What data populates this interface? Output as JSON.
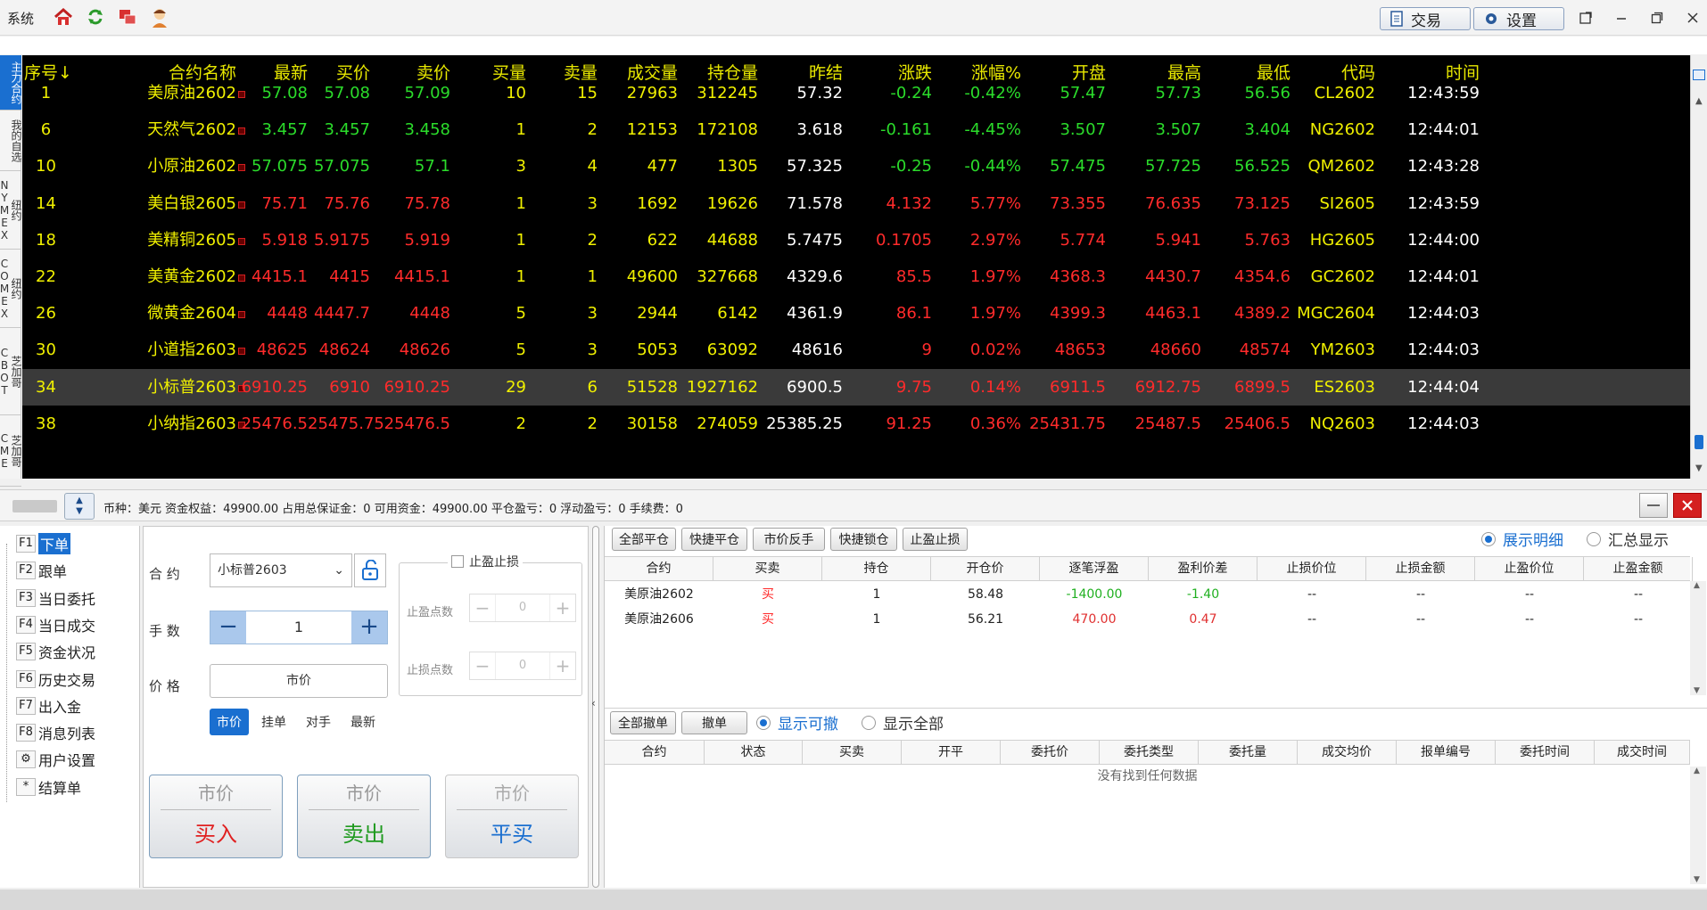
{
  "titlebar": {
    "system_label": "系统",
    "trade_button": "交易",
    "settings_button": "设置",
    "icons": [
      "home-icon",
      "refresh-icon",
      "windows-icon",
      "user-avatar-icon"
    ]
  },
  "side_tabs": [
    "主力合约",
    "我的自选",
    "纽约NYMEX",
    "纽约COMEX",
    "芝加哥CBOT",
    "芝加哥CME"
  ],
  "market": {
    "headers": [
      "序号↓",
      "合约名称",
      "最新",
      "买价",
      "卖价",
      "买量",
      "卖量",
      "成交量",
      "持仓量",
      "昨结",
      "涨跌",
      "涨幅%",
      "开盘",
      "最高",
      "最低",
      "代码",
      "时间"
    ],
    "rows": [
      {
        "no": "1",
        "name": "美原油2602",
        "last": "57.08",
        "bid": "57.08",
        "ask": "57.09",
        "bidv": "10",
        "askv": "15",
        "vol": "27963",
        "oi": "312245",
        "prev": "57.32",
        "chg": "-0.24",
        "pct": "-0.42%",
        "open": "57.47",
        "high": "57.73",
        "low": "56.56",
        "code": "CL2602",
        "time": "12:43:59",
        "dir": "down"
      },
      {
        "no": "6",
        "name": "天然气2602",
        "last": "3.457",
        "bid": "3.457",
        "ask": "3.458",
        "bidv": "1",
        "askv": "2",
        "vol": "12153",
        "oi": "172108",
        "prev": "3.618",
        "chg": "-0.161",
        "pct": "-4.45%",
        "open": "3.507",
        "high": "3.507",
        "low": "3.404",
        "code": "NG2602",
        "time": "12:44:01",
        "dir": "down"
      },
      {
        "no": "10",
        "name": "小原油2602",
        "last": "57.075",
        "bid": "57.075",
        "ask": "57.1",
        "bidv": "3",
        "askv": "4",
        "vol": "477",
        "oi": "1305",
        "prev": "57.325",
        "chg": "-0.25",
        "pct": "-0.44%",
        "open": "57.475",
        "high": "57.725",
        "low": "56.525",
        "code": "QM2602",
        "time": "12:43:28",
        "dir": "down"
      },
      {
        "no": "14",
        "name": "美白银2605",
        "last": "75.71",
        "bid": "75.76",
        "ask": "75.78",
        "bidv": "1",
        "askv": "3",
        "vol": "1692",
        "oi": "19626",
        "prev": "71.578",
        "chg": "4.132",
        "pct": "5.77%",
        "open": "73.355",
        "high": "76.635",
        "low": "73.125",
        "code": "SI2605",
        "time": "12:43:59",
        "dir": "up"
      },
      {
        "no": "18",
        "name": "美精铜2605",
        "last": "5.918",
        "bid": "5.9175",
        "ask": "5.919",
        "bidv": "1",
        "askv": "2",
        "vol": "622",
        "oi": "44688",
        "prev": "5.7475",
        "chg": "0.1705",
        "pct": "2.97%",
        "open": "5.774",
        "high": "5.941",
        "low": "5.763",
        "code": "HG2605",
        "time": "12:44:00",
        "dir": "up"
      },
      {
        "no": "22",
        "name": "美黄金2602",
        "last": "4415.1",
        "bid": "4415",
        "ask": "4415.1",
        "bidv": "1",
        "askv": "1",
        "vol": "49600",
        "oi": "327668",
        "prev": "4329.6",
        "chg": "85.5",
        "pct": "1.97%",
        "open": "4368.3",
        "high": "4430.7",
        "low": "4354.6",
        "code": "GC2602",
        "time": "12:44:01",
        "dir": "up"
      },
      {
        "no": "26",
        "name": "微黄金2604",
        "last": "4448",
        "bid": "4447.7",
        "ask": "4448",
        "bidv": "5",
        "askv": "3",
        "vol": "2944",
        "oi": "6142",
        "prev": "4361.9",
        "chg": "86.1",
        "pct": "1.97%",
        "open": "4399.3",
        "high": "4463.1",
        "low": "4389.2",
        "code": "MGC2604",
        "time": "12:44:03",
        "dir": "up"
      },
      {
        "no": "30",
        "name": "小道指2603",
        "last": "48625",
        "bid": "48624",
        "ask": "48626",
        "bidv": "5",
        "askv": "3",
        "vol": "5053",
        "oi": "63092",
        "prev": "48616",
        "chg": "9",
        "pct": "0.02%",
        "open": "48653",
        "high": "48660",
        "low": "48574",
        "code": "YM2603",
        "time": "12:44:03",
        "dir": "up"
      },
      {
        "no": "34",
        "name": "小标普2603",
        "last": "6910.25",
        "bid": "6910",
        "ask": "6910.25",
        "bidv": "29",
        "askv": "6",
        "vol": "51528",
        "oi": "1927162",
        "prev": "6900.5",
        "chg": "9.75",
        "pct": "0.14%",
        "open": "6911.5",
        "high": "6912.75",
        "low": "6899.5",
        "code": "ES2603",
        "time": "12:44:04",
        "dir": "up",
        "selected": true
      },
      {
        "no": "38",
        "name": "小纳指2603",
        "last": "25476.5",
        "bid": "25475.75",
        "ask": "25476.5",
        "bidv": "2",
        "askv": "2",
        "vol": "30158",
        "oi": "274059",
        "prev": "25385.25",
        "chg": "91.25",
        "pct": "0.36%",
        "open": "25431.75",
        "high": "25487.5",
        "low": "25406.5",
        "code": "NQ2603",
        "time": "12:44:03",
        "dir": "up"
      }
    ]
  },
  "status": {
    "text": "币种：美元   资金权益：49900.00   占用总保证金：0   可用资金：49900.00   平仓盈亏：0   浮动盈亏：0   手续费：0"
  },
  "nav": [
    {
      "key": "F1",
      "label": "下单",
      "active": true
    },
    {
      "key": "F2",
      "label": "跟单"
    },
    {
      "key": "F3",
      "label": "当日委托"
    },
    {
      "key": "F4",
      "label": "当日成交"
    },
    {
      "key": "F5",
      "label": "资金状况"
    },
    {
      "key": "F6",
      "label": "历史交易"
    },
    {
      "key": "F7",
      "label": "出入金"
    },
    {
      "key": "F8",
      "label": "消息列表"
    },
    {
      "key": "⚙",
      "label": "用户设置"
    },
    {
      "key": "*",
      "label": "结算单"
    }
  ],
  "order": {
    "contract_label": "合  约",
    "contract_value": "小标普2603",
    "qty_label": "手  数",
    "qty_value": "1",
    "price_label": "价  格",
    "price_value": "市价",
    "price_types": [
      "市价",
      "挂单",
      "对手",
      "最新"
    ],
    "stop_title": "止盈止损",
    "stop_profit_label": "止盈点数",
    "stop_loss_label": "止损点数",
    "stop_profit_value": "0",
    "stop_loss_value": "0",
    "buy": {
      "top": "市价",
      "bottom": "买入"
    },
    "sell": {
      "top": "市价",
      "bottom": "卖出"
    },
    "close": {
      "top": "市价",
      "bottom": "平买"
    }
  },
  "positions": {
    "buttons": [
      "全部平仓",
      "快捷平仓",
      "市价反手",
      "快捷锁仓",
      "止盈止损"
    ],
    "radio_detail": "展示明细",
    "radio_summary": "汇总显示",
    "headers": [
      "合约",
      "买卖",
      "持仓",
      "开仓价",
      "逐笔浮盈",
      "盈利价差",
      "止损价位",
      "止损金额",
      "止盈价位",
      "止盈金额"
    ],
    "rows": [
      {
        "contract": "美原油2602",
        "side": "买",
        "qty": "1",
        "open": "58.48",
        "pnl": "-1400.00",
        "diff": "-1.40",
        "sl": "--",
        "sla": "--",
        "tp": "--",
        "tpa": "--",
        "dir": "down"
      },
      {
        "contract": "美原油2606",
        "side": "买",
        "qty": "1",
        "open": "56.21",
        "pnl": "470.00",
        "diff": "0.47",
        "sl": "--",
        "sla": "--",
        "tp": "--",
        "tpa": "--",
        "dir": "up"
      }
    ]
  },
  "orders": {
    "buttons": [
      "全部撤单",
      "撤单"
    ],
    "radio_cancelable": "显示可撤",
    "radio_all": "显示全部",
    "headers": [
      "合约",
      "状态",
      "买卖",
      "开平",
      "委托价",
      "委托类型",
      "委托量",
      "成交均价",
      "报单编号",
      "委托时间",
      "成交时间"
    ],
    "empty": "没有找到任何数据"
  },
  "colors": {
    "up": "#ff2b2b",
    "down": "#2bdc2b",
    "yellow": "#f0f000",
    "cyan": "#00c8ff",
    "accent": "#1a6fd0"
  }
}
